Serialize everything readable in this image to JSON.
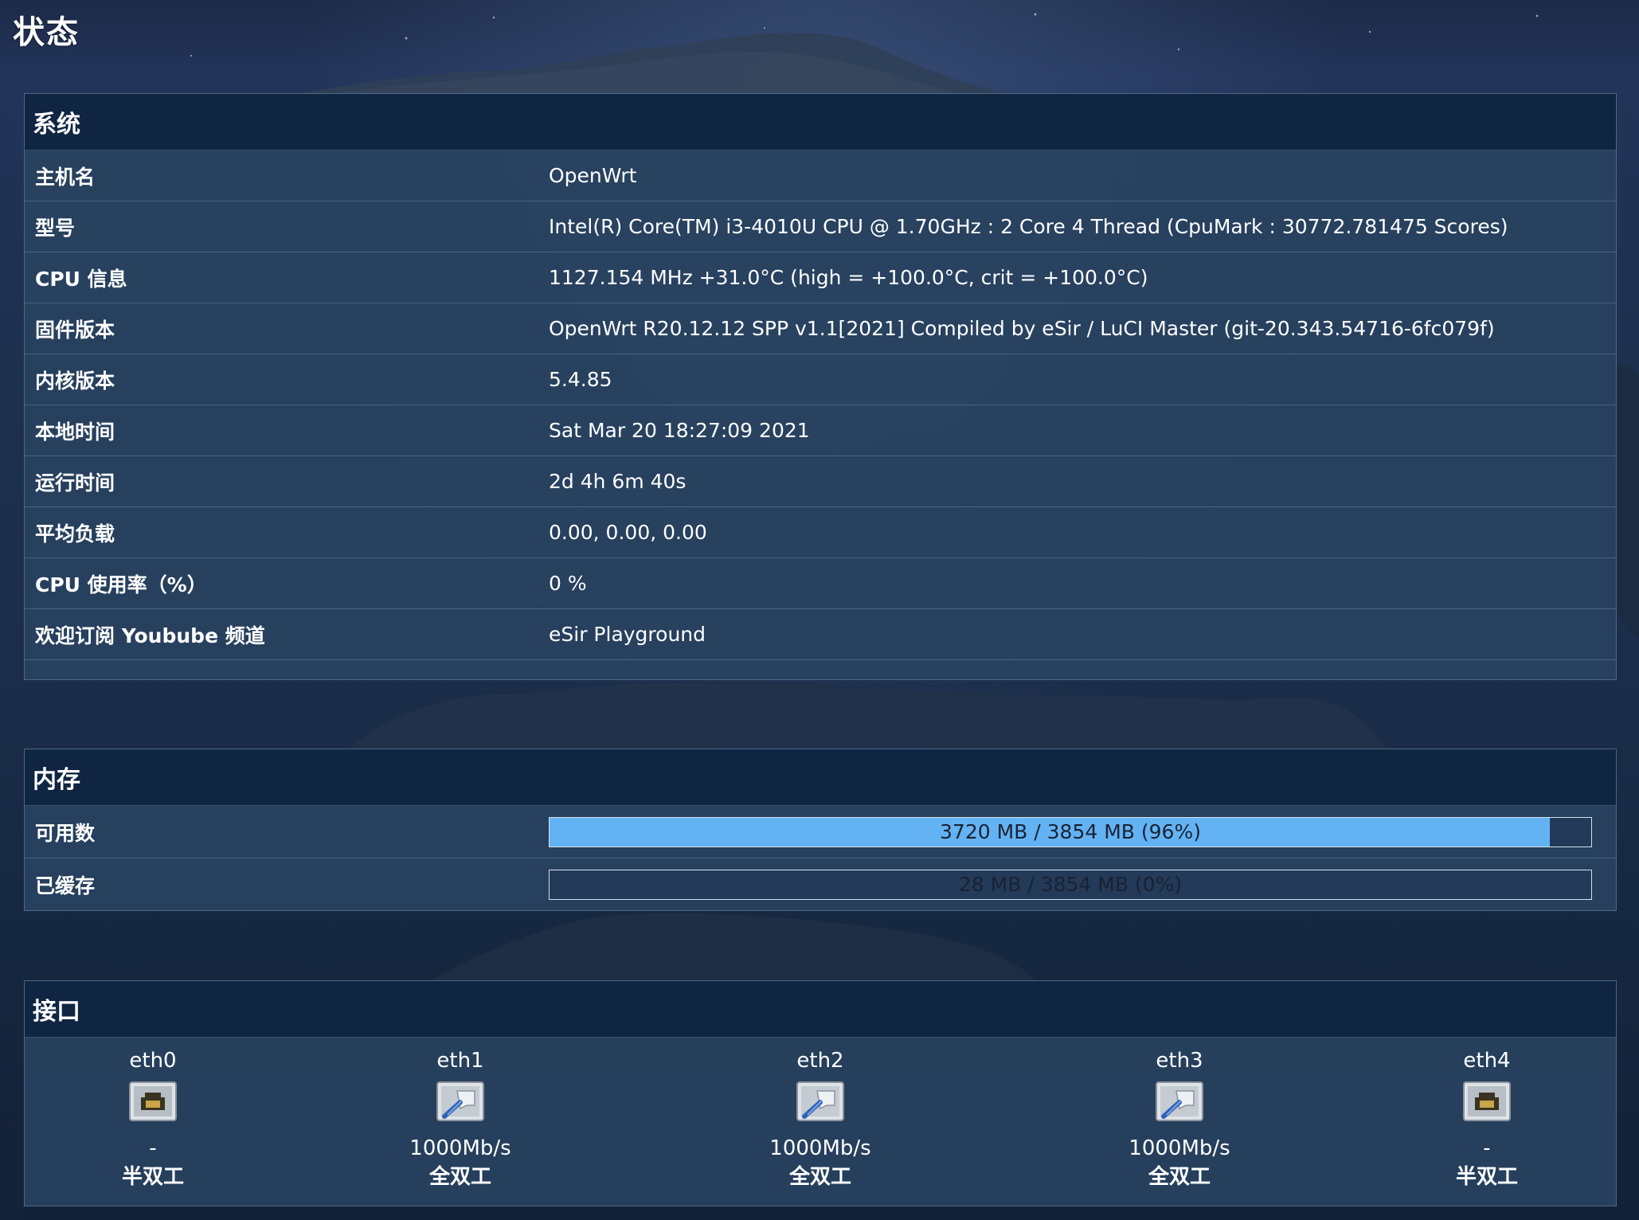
{
  "page": {
    "title": "状态"
  },
  "system": {
    "header": "系统",
    "rows": [
      {
        "label": "主机名",
        "value": "OpenWrt"
      },
      {
        "label": "型号",
        "value": "Intel(R) Core(TM) i3-4010U CPU @ 1.70GHz : 2 Core 4 Thread (CpuMark : 30772.781475 Scores)"
      },
      {
        "label": "CPU 信息",
        "value": "1127.154 MHz +31.0°C (high = +100.0°C, crit = +100.0°C)"
      },
      {
        "label": "固件版本",
        "value": "OpenWrt R20.12.12 SPP v1.1[2021] Compiled by eSir / LuCI Master (git-20.343.54716-6fc079f)"
      },
      {
        "label": "内核版本",
        "value": "5.4.85"
      },
      {
        "label": "本地时间",
        "value": "Sat Mar 20 18:27:09 2021"
      },
      {
        "label": "运行时间",
        "value": "2d 4h 6m 40s"
      },
      {
        "label": "平均负载",
        "value": "0.00, 0.00, 0.00"
      },
      {
        "label": "CPU 使用率（%）",
        "value": "0 %"
      },
      {
        "label": "欢迎订阅 Youbube 频道",
        "value": "eSir Playground"
      }
    ]
  },
  "memory": {
    "header": "内存",
    "rows": [
      {
        "label": "可用数",
        "bar_text": "3720 MB / 3854 MB (96%)",
        "percent": 96
      },
      {
        "label": "已缓存",
        "bar_text": "28 MB / 3854 MB (0%)",
        "percent": 0
      }
    ]
  },
  "interfaces": {
    "header": "接口",
    "ports": [
      {
        "name": "eth0",
        "speed": "-",
        "duplex": "半双工",
        "connected": false
      },
      {
        "name": "eth1",
        "speed": "1000Mb/s",
        "duplex": "全双工",
        "connected": true
      },
      {
        "name": "eth2",
        "speed": "1000Mb/s",
        "duplex": "全双工",
        "connected": true
      },
      {
        "name": "eth3",
        "speed": "1000Mb/s",
        "duplex": "全双工",
        "connected": true
      },
      {
        "name": "eth4",
        "speed": "-",
        "duplex": "半双工",
        "connected": false
      }
    ]
  },
  "colors": {
    "bar_fill": "#63b3f4",
    "header_bg": "#0f2541",
    "panel_bg": "#284260"
  },
  "icons": {
    "port_down": "ethernet-port-disconnected-icon",
    "port_up": "ethernet-port-connected-icon"
  }
}
